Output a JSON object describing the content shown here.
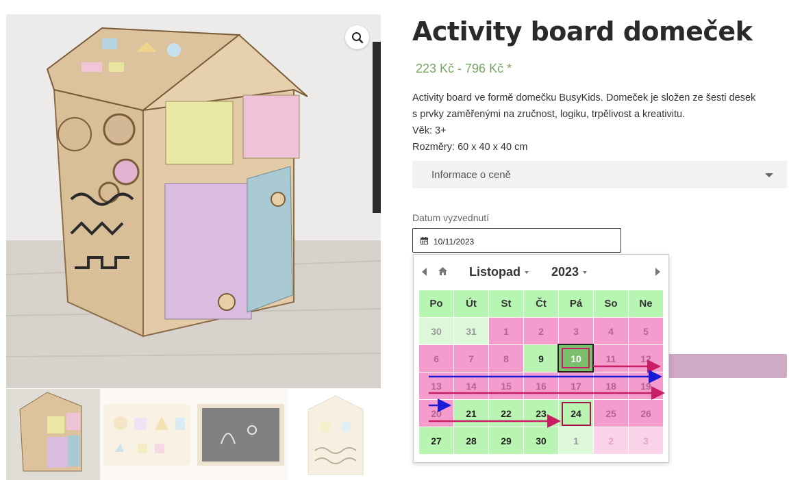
{
  "product": {
    "title": "Activity board domeček",
    "price": "223 Kč - 796 Kč *",
    "description_lines": [
      "Activity board ve formě domečku BusyKids. Domeček je složen ze šesti desek",
      "s prvky zaměřenými na zručnost, logiku, trpělivost a kreativitu.",
      "Věk: 3+",
      "Rozměry: 60 x 40 x 40 cm"
    ],
    "accordion_label": "Informace o ceně"
  },
  "form": {
    "date_label": "Datum vyzvednutí",
    "date_value": "10/11/2023"
  },
  "datepicker": {
    "month": "Listopad",
    "year": "2023",
    "weekdays": [
      "Po",
      "Út",
      "St",
      "Čt",
      "Pá",
      "So",
      "Ne"
    ],
    "weeks": [
      [
        {
          "d": "30",
          "s": "other-green"
        },
        {
          "d": "31",
          "s": "other-green"
        },
        {
          "d": "1",
          "s": "blocked"
        },
        {
          "d": "2",
          "s": "blocked"
        },
        {
          "d": "3",
          "s": "blocked"
        },
        {
          "d": "4",
          "s": "blocked"
        },
        {
          "d": "5",
          "s": "blocked"
        }
      ],
      [
        {
          "d": "6",
          "s": "blocked"
        },
        {
          "d": "7",
          "s": "blocked"
        },
        {
          "d": "8",
          "s": "blocked"
        },
        {
          "d": "9",
          "s": "avail"
        },
        {
          "d": "10",
          "s": "selected"
        },
        {
          "d": "11",
          "s": "blocked"
        },
        {
          "d": "12",
          "s": "blocked"
        }
      ],
      [
        {
          "d": "13",
          "s": "blocked"
        },
        {
          "d": "14",
          "s": "blocked"
        },
        {
          "d": "15",
          "s": "blocked"
        },
        {
          "d": "16",
          "s": "blocked"
        },
        {
          "d": "17",
          "s": "blocked"
        },
        {
          "d": "18",
          "s": "blocked"
        },
        {
          "d": "19",
          "s": "blocked"
        }
      ],
      [
        {
          "d": "20",
          "s": "blocked"
        },
        {
          "d": "21",
          "s": "avail"
        },
        {
          "d": "22",
          "s": "avail"
        },
        {
          "d": "23",
          "s": "avail"
        },
        {
          "d": "24",
          "s": "avail"
        },
        {
          "d": "25",
          "s": "blocked"
        },
        {
          "d": "26",
          "s": "blocked"
        }
      ],
      [
        {
          "d": "27",
          "s": "avail"
        },
        {
          "d": "28",
          "s": "avail"
        },
        {
          "d": "29",
          "s": "avail"
        },
        {
          "d": "30",
          "s": "avail"
        },
        {
          "d": "1",
          "s": "other-green"
        },
        {
          "d": "2",
          "s": "other-pink"
        },
        {
          "d": "3",
          "s": "other-pink"
        }
      ]
    ],
    "selected_date": "10",
    "highlighted_date": "24"
  },
  "colors": {
    "price": "#77a464",
    "available": "#b9f4b3",
    "blocked": "#f49ccd",
    "selected": "#7ac06c",
    "annotation_magenta": "#c81e63",
    "annotation_blue": "#1a1ad6",
    "button": "#d0a9c5"
  },
  "icons": [
    "zoom-icon",
    "calendar-icon",
    "home-icon",
    "prev-month-icon",
    "next-month-icon",
    "dropdown-caret-icon"
  ]
}
